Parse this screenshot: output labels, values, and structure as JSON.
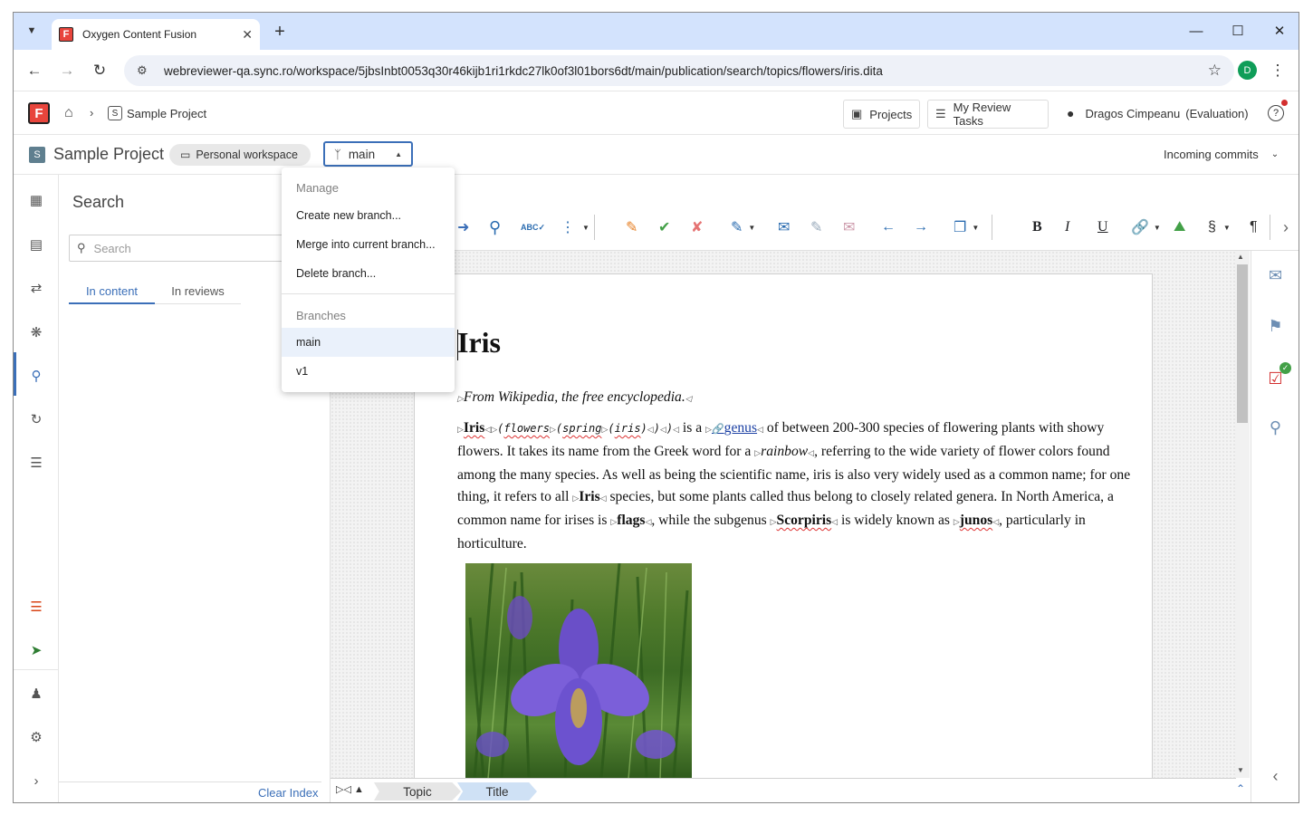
{
  "browser": {
    "tab_title": "Oxygen Content Fusion",
    "url": "webreviewer-qa.sync.ro/workspace/5jbsInbt0053q30r46kijb1ri1rkdc27lk0of3l01bors6dt/main/publication/search/topics/flowers/iris.dita",
    "profile_initial": "D",
    "favicon_letter": "F"
  },
  "header": {
    "logo_letter": "F",
    "project_badge": "S",
    "breadcrumb_project": "Sample Project",
    "projects_label": "Projects",
    "review_tasks_label": "My Review Tasks",
    "user_name": "Dragos Cimpeanu",
    "user_status": "(Evaluation)"
  },
  "projectbar": {
    "badge": "S",
    "title": "Sample Project",
    "workspace_label": "Personal workspace",
    "branch": "main",
    "incoming_commits": "Incoming commits"
  },
  "branch_menu": {
    "manage_header": "Manage",
    "actions": [
      "Create new branch...",
      "Merge into current branch...",
      "Delete branch..."
    ],
    "branches_header": "Branches",
    "branches": [
      "main",
      "v1"
    ],
    "selected_branch": "main"
  },
  "search_panel": {
    "title": "Search",
    "placeholder": "Search",
    "tabs": [
      "In content",
      "In reviews"
    ],
    "active_tab": "In content",
    "clear_index": "Clear Index"
  },
  "document": {
    "title": "Iris",
    "shortdesc": "From Wikipedia, the free encyclopedia.",
    "p_iris": "Iris",
    "p_codes": [
      "flowers",
      "spring",
      "iris"
    ],
    "p_isa": " is a ",
    "p_link": "genus",
    "p_t1": " of between 200-300 species of flowering plants with showy flowers. It takes its name from the Greek word for a ",
    "p_rainbow": "rainbow",
    "p_t2": ", referring to the wide variety of flower colors found among the many species. As well as being the scientific name, iris is also very widely used as a common name; for one thing, it refers to all ",
    "p_iris2": "Iris",
    "p_t3": " species, but some plants called thus belong to closely related genera. In North America, a common name for irises is ",
    "p_flags": "flags",
    "p_t4": ", while the subgenus ",
    "p_scorpiris": "Scorpiris",
    "p_t5": " is widely known as ",
    "p_junos": "junos",
    "p_t6": ", particularly in horticulture."
  },
  "breadcrumbs": [
    "Topic",
    "Title"
  ],
  "colors": {
    "accent": "#3b6fb8",
    "titlebar": "#d3e3fd",
    "brand": "#e8453c"
  }
}
